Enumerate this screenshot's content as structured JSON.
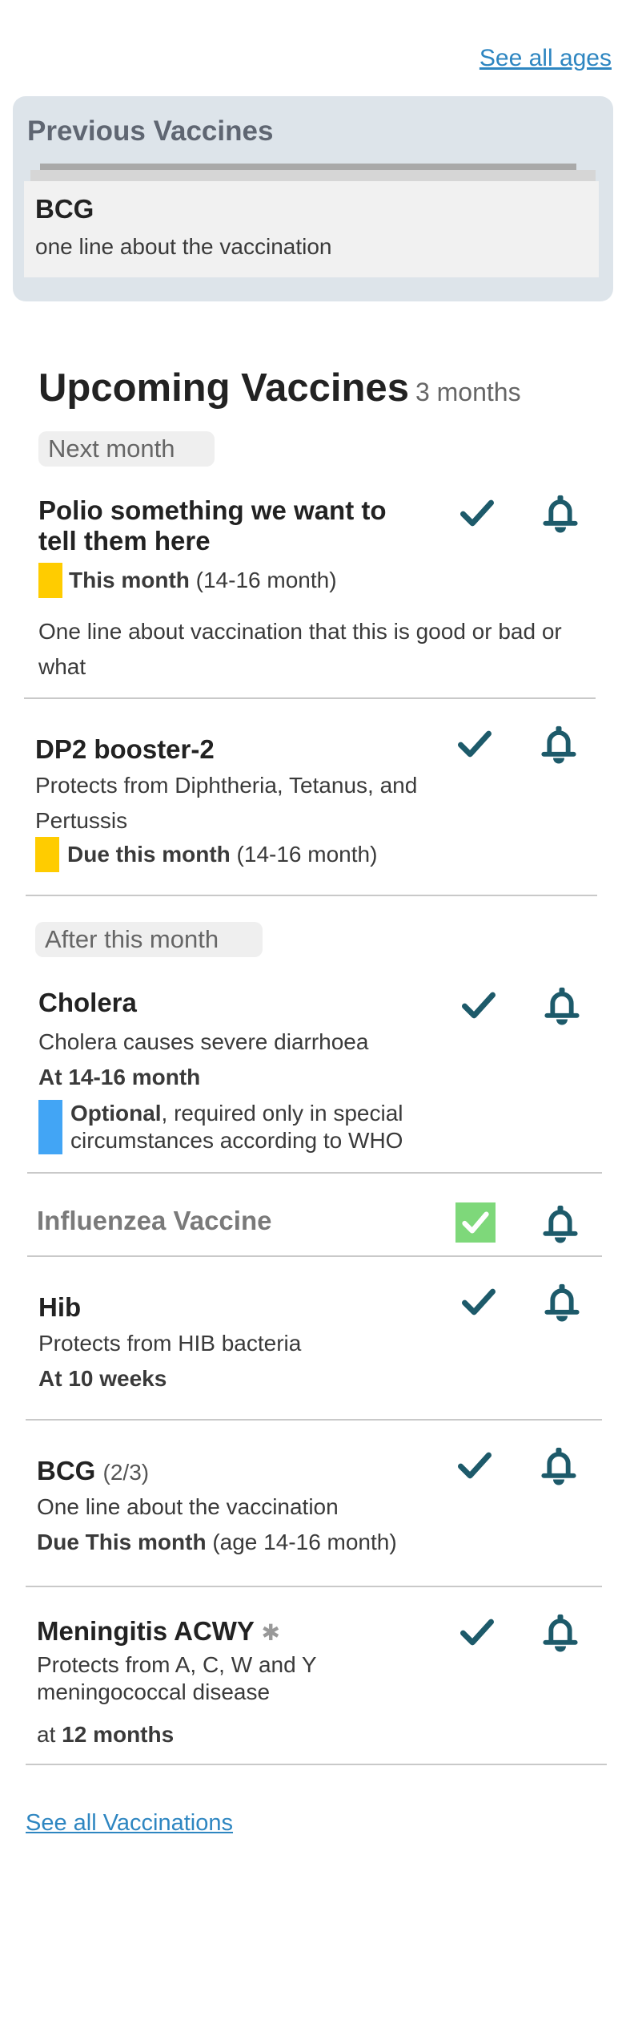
{
  "header": {
    "see_all_ages": "See all ages"
  },
  "previous": {
    "title": "Previous Vaccines",
    "card": {
      "name": "BCG",
      "description": "one line about the vaccination"
    }
  },
  "upcoming": {
    "title": "Upcoming Vaccines",
    "age": "3 months"
  },
  "sections": {
    "next_month": "Next month",
    "after_this_month": "After this month"
  },
  "vaccines": {
    "polio": {
      "name": "Polio something we want to tell them here",
      "when_bold": "This month",
      "when_rest": " (14-16 month)",
      "description": "One line about vaccination that this is good or bad or what"
    },
    "dp2": {
      "name": "DP2 booster-2",
      "description": "Protects from Diphtheria, Tetanus, and Pertussis",
      "when_bold": "Due this month",
      "when_rest": " (14-16 month)"
    },
    "cholera": {
      "name": "Cholera",
      "description": "Cholera causes severe diarrhoea",
      "when": "At 14-16 month",
      "optional_bold": "Optional",
      "optional_rest": ", required only in special circumstances according to WHO"
    },
    "influenza": {
      "name": "Influenzea Vaccine"
    },
    "hib": {
      "name": "Hib",
      "description": "Protects from HIB bacteria",
      "when": "At 10 weeks"
    },
    "bcg": {
      "name": "BCG",
      "dose": "(2/3)",
      "description": "One line about the vaccination",
      "when_bold": "Due This month",
      "when_rest": " (age 14-16 month)"
    },
    "meningitis": {
      "name": "Meningitis ACWY",
      "marker": "✱",
      "description": "Protects from A, C, W and Y meningococcal disease",
      "when_prefix": "at ",
      "when_bold": "12 months"
    }
  },
  "footer": {
    "see_all_vaccinations": "See all Vaccinations"
  },
  "colors": {
    "teal_icon": "#1d5a6a",
    "yellow_flag": "#ffcc00",
    "blue_flag": "#42a5f5",
    "green_check": "#7ed87a",
    "link": "#2e86c1"
  }
}
